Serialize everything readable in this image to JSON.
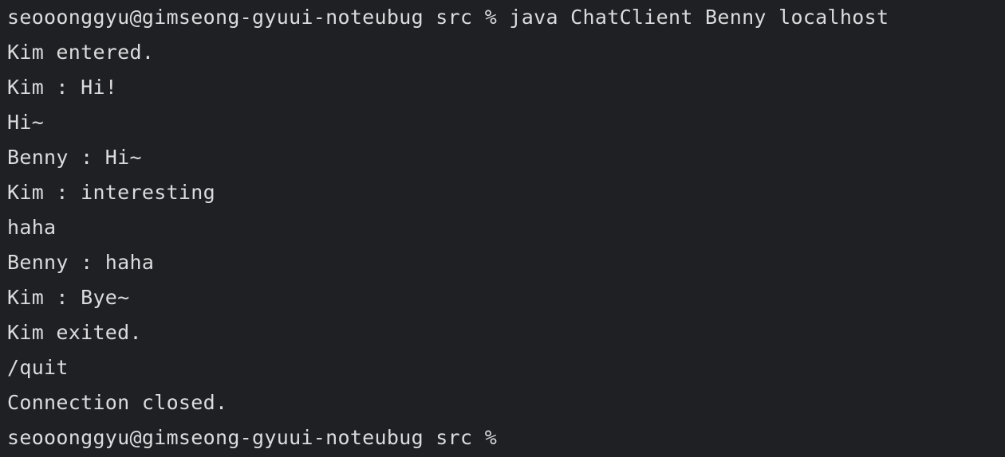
{
  "terminal": {
    "lines": [
      "seooonggyu@gimseong-gyuui-noteubug src % java ChatClient Benny localhost",
      "Kim entered.",
      "Kim : Hi!",
      "Hi~",
      "Benny : Hi~",
      "Kim : interesting",
      "haha",
      "Benny : haha",
      "Kim : Bye~",
      "Kim exited.",
      "/quit",
      "Connection closed.",
      "seooonggyu@gimseong-gyuui-noteubug src %"
    ]
  },
  "colors": {
    "background": "#1f2024",
    "text": "#dcdcde"
  }
}
